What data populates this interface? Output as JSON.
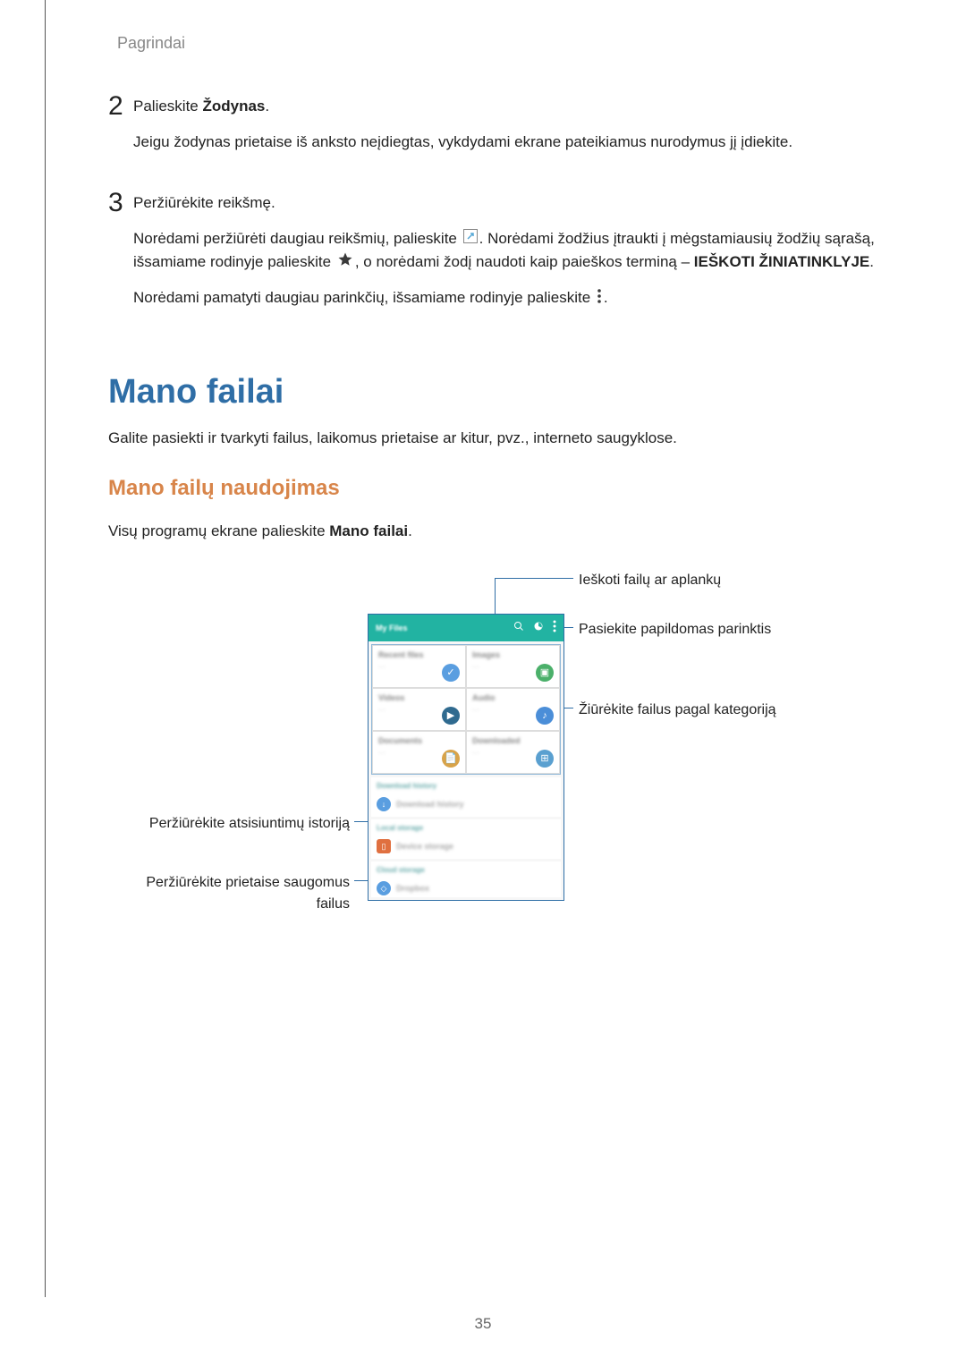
{
  "header": "Pagrindai",
  "step2": {
    "num": "2",
    "line1_prefix": "Palieskite ",
    "line1_bold": "Žodynas",
    "line1_suffix": ".",
    "line2": "Jeigu žodynas prietaise iš anksto neįdiegtas, vykdydami ekrane pateikiamus nurodymus jį įdiekite."
  },
  "step3": {
    "num": "3",
    "line1": "Peržiūrėkite reikšmę.",
    "line2a": "Norėdami peržiūrėti daugiau reikšmių, palieskite ",
    "line2b": ". Norėdami žodžius įtraukti į mėgstamiausių žodžių sąrašą, išsamiame rodinyje palieskite ",
    "line2c": ", o norėdami žodį naudoti kaip paieškos terminą – ",
    "line2_bold": "IEŠKOTI ŽINIATINKLYJE",
    "line2d": ".",
    "line3a": "Norėdami pamatyti daugiau parinkčių, išsamiame rodinyje palieskite ",
    "line3b": "."
  },
  "section_title": "Mano failai",
  "intro": "Galite pasiekti ir tvarkyti failus, laikomus prietaise ar kitur, pvz., interneto saugyklose.",
  "sub_title": "Mano failų naudojimas",
  "sub_intro_prefix": "Visų programų ekrane palieskite ",
  "sub_intro_bold": "Mano failai",
  "sub_intro_suffix": ".",
  "callouts": {
    "search": "Ieškoti failų ar aplankų",
    "more": "Pasiekite papildomas parinktis",
    "category": "Žiūrėkite failus pagal kategoriją",
    "downloads": "Peržiūrėkite atsisiuntimų istoriją",
    "device": "Peržiūrėkite prietaise saugomus failus"
  },
  "screenshot": {
    "title": "My Files",
    "tiles": [
      "Recent files",
      "Images",
      "Videos",
      "Audio",
      "Documents",
      "Downloaded"
    ],
    "sections": {
      "download_header": "Download history",
      "download_row": "Download history",
      "local_header": "Local storage",
      "local_row": "Device storage",
      "cloud_header": "Cloud storage",
      "cloud_row": "Dropbox"
    }
  },
  "page_number": "35"
}
